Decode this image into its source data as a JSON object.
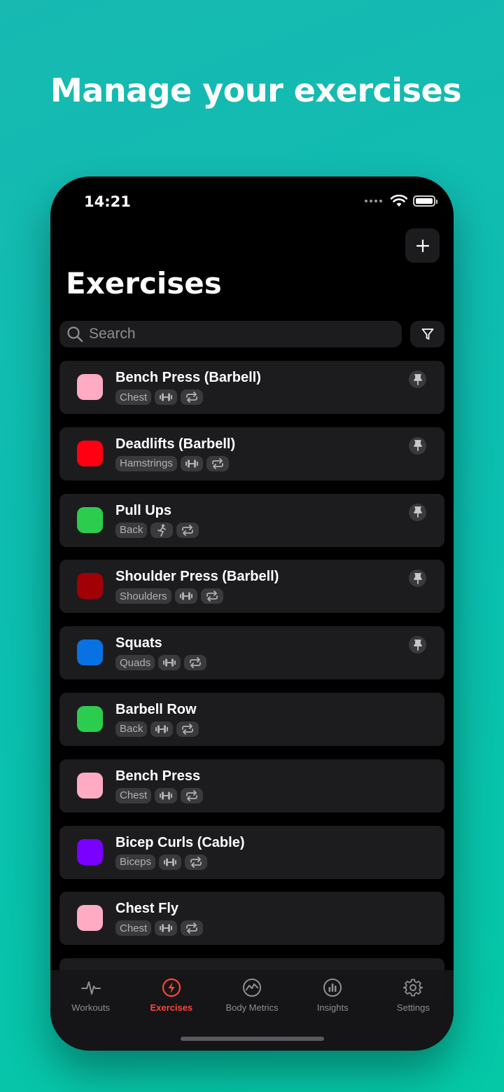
{
  "headline": "Manage your exercises",
  "status": {
    "time": "14:21"
  },
  "page": {
    "title": "Exercises",
    "add_icon": "plus-icon"
  },
  "search": {
    "placeholder": "Search",
    "icon": "search-icon",
    "filter_icon": "filter-icon"
  },
  "exercises": [
    {
      "name": "Bench Press (Barbell)",
      "muscle": "Chest",
      "color": "#ffabc4",
      "equipment_icon": "dumbbell-icon",
      "pinned": true
    },
    {
      "name": "Deadlifts (Barbell)",
      "muscle": "Hamstrings",
      "color": "#ff0012",
      "equipment_icon": "dumbbell-icon",
      "pinned": true
    },
    {
      "name": "Pull Ups",
      "muscle": "Back",
      "color": "#2ccc4f",
      "equipment_icon": "bodyweight-icon",
      "pinned": true
    },
    {
      "name": "Shoulder Press (Barbell)",
      "muscle": "Shoulders",
      "color": "#a00006",
      "equipment_icon": "dumbbell-icon",
      "pinned": true
    },
    {
      "name": "Squats",
      "muscle": "Quads",
      "color": "#0872e2",
      "equipment_icon": "dumbbell-icon",
      "pinned": true
    },
    {
      "name": "Barbell Row",
      "muscle": "Back",
      "color": "#2ccc4f",
      "equipment_icon": "dumbbell-icon",
      "pinned": false
    },
    {
      "name": "Bench Press",
      "muscle": "Chest",
      "color": "#ffabc4",
      "equipment_icon": "dumbbell-icon",
      "pinned": false
    },
    {
      "name": "Bicep Curls (Cable)",
      "muscle": "Biceps",
      "color": "#7a00ff",
      "equipment_icon": "dumbbell-icon",
      "pinned": false
    },
    {
      "name": "Chest Fly",
      "muscle": "Chest",
      "color": "#ffabc4",
      "equipment_icon": "dumbbell-icon",
      "pinned": false
    }
  ],
  "tabs": [
    {
      "label": "Workouts",
      "icon": "pulse-icon",
      "active": false
    },
    {
      "label": "Exercises",
      "icon": "bolt-icon",
      "active": true
    },
    {
      "label": "Body Metrics",
      "icon": "chart-line-icon",
      "active": false
    },
    {
      "label": "Insights",
      "icon": "bar-chart-icon",
      "active": false
    },
    {
      "label": "Settings",
      "icon": "gear-icon",
      "active": false
    }
  ],
  "colors": {
    "accent": "#ff453a",
    "background": "#000000",
    "card": "#1c1c1e"
  }
}
